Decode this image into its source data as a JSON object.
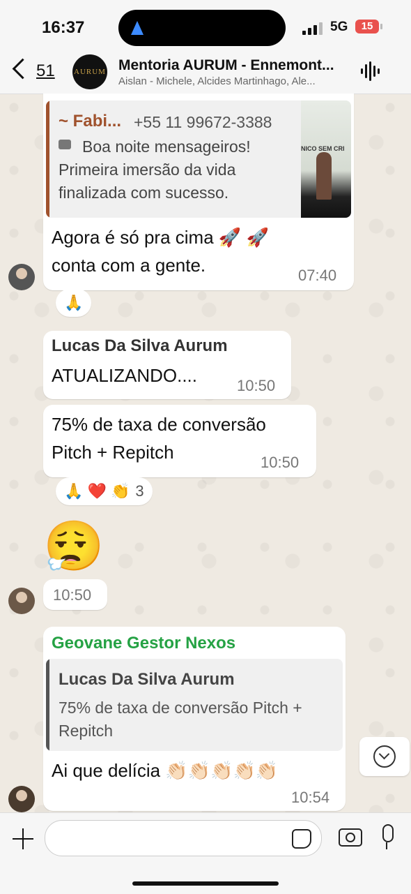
{
  "status_bar": {
    "time": "16:37",
    "network": "5G",
    "battery": "15"
  },
  "header": {
    "back_count": "51",
    "avatar_label": "AURUM",
    "title": "Mentoria AURUM - Ennemont...",
    "subtitle": "Aislan - Michele, Alcides Martinhago, Ale..."
  },
  "messages": {
    "m1": {
      "quote_author": "~ Fabi...",
      "quote_phone": "+55 11 99672-3388",
      "quote_text": "Boa noite mensageiros! Primeira imersão da vida finalizada com sucesso.",
      "quote_image_text": "NICO SEM CRI",
      "text_line1": "Agora é só pra cima 🚀 🚀",
      "text_line2": "conta com a gente.",
      "time": "07:40",
      "reaction": "🙏"
    },
    "m2": {
      "sender": "Lucas Da Silva Aurum",
      "text": "ATUALIZANDO....",
      "time": "10:50"
    },
    "m3": {
      "text_line1": "75% de taxa de conversão",
      "text_line2": "Pitch + Repitch",
      "time": "10:50",
      "reactions": "🙏 ❤️ 👏",
      "reaction_count": "3"
    },
    "m4": {
      "emoji": "😮‍💨",
      "time": "10:50"
    },
    "m5": {
      "sender": "Geovane Gestor Nexos",
      "quote_author": "Lucas Da Silva Aurum",
      "quote_text": "75% de taxa de conversão Pitch + Repitch",
      "text": "Ai que delícia 👏🏻👏🏻👏🏻👏🏻👏🏻",
      "time": "10:54"
    }
  },
  "colors": {
    "quote_bar_m1": "#a0522d",
    "sender_m5": "#25a244",
    "quote_bar_m5": "#555555"
  }
}
